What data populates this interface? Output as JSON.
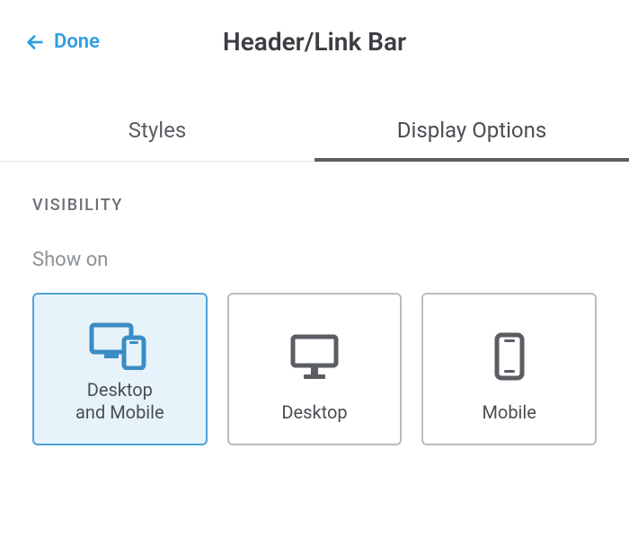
{
  "header": {
    "back_label": "Done",
    "title": "Header/Link Bar"
  },
  "tabs": [
    {
      "label": "Styles",
      "active": false
    },
    {
      "label": "Display Options",
      "active": true
    }
  ],
  "section": {
    "heading": "VISIBILITY",
    "field_label": "Show on",
    "options": [
      {
        "label": "Desktop\nand Mobile",
        "selected": true,
        "icon": "desktop-mobile-icon"
      },
      {
        "label": "Desktop",
        "selected": false,
        "icon": "desktop-icon"
      },
      {
        "label": "Mobile",
        "selected": false,
        "icon": "mobile-icon"
      }
    ]
  },
  "colors": {
    "accent": "#2e9ee2",
    "selected_bg": "#e7f3fb",
    "selected_border": "#4fa3d8",
    "icon_inactive": "#5a5e63"
  }
}
